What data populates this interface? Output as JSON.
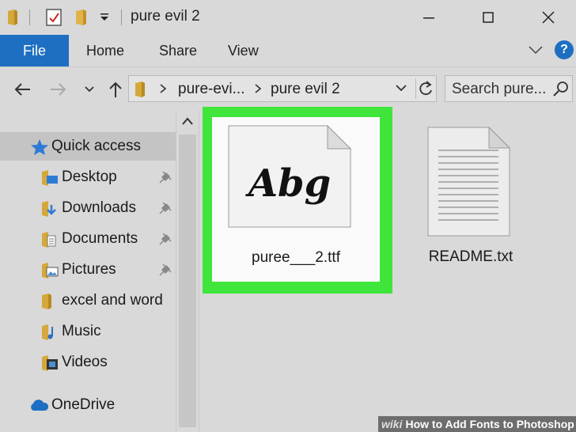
{
  "window": {
    "title": "pure evil 2"
  },
  "ribbon": {
    "file": "File",
    "tabs": [
      "Home",
      "Share",
      "View"
    ],
    "help": "?"
  },
  "address": {
    "crumbs": [
      "pure-evi...",
      "pure evil 2"
    ],
    "search_placeholder": "Search pure..."
  },
  "nav": {
    "quick_access": "Quick access",
    "items": [
      {
        "label": "Desktop",
        "icon": "desktop-folder-icon",
        "pinned": true
      },
      {
        "label": "Downloads",
        "icon": "downloads-folder-icon",
        "pinned": true
      },
      {
        "label": "Documents",
        "icon": "documents-folder-icon",
        "pinned": true
      },
      {
        "label": "Pictures",
        "icon": "pictures-folder-icon",
        "pinned": true
      },
      {
        "label": "excel and word",
        "icon": "folder-icon",
        "pinned": false
      },
      {
        "label": "Music",
        "icon": "music-folder-icon",
        "pinned": false
      },
      {
        "label": "Videos",
        "icon": "videos-folder-icon",
        "pinned": false
      }
    ],
    "onedrive": "OneDrive"
  },
  "files": [
    {
      "name": "puree___2.ttf",
      "type": "font",
      "preview": "Abg",
      "selected": true
    },
    {
      "name": "README.txt",
      "type": "text",
      "selected": false
    }
  ],
  "watermark": {
    "brand": "wiki",
    "text": "How to Add Fonts to Photoshop"
  },
  "colors": {
    "accent": "#1e6fc2",
    "highlight": "#3fe53b",
    "window_bg": "#d9d9d9"
  }
}
